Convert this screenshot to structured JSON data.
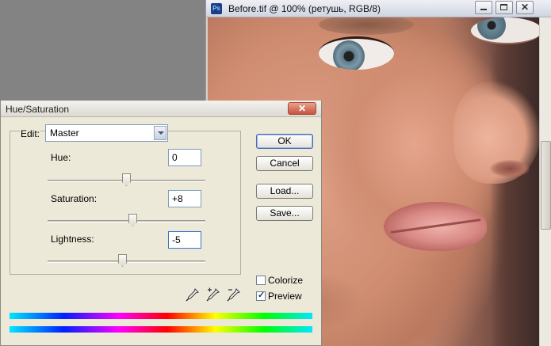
{
  "document": {
    "title": "Before.tif @ 100% (ретушь, RGB/8)",
    "icon": "photoshop-file-icon"
  },
  "dialog": {
    "title": "Hue/Saturation",
    "edit_label": "Edit:",
    "edit_value": "Master",
    "sliders": [
      {
        "label": "Hue:",
        "value": "0",
        "position_fraction": 0.5
      },
      {
        "label": "Saturation:",
        "value": "+8",
        "position_fraction": 0.54
      },
      {
        "label": "Lightness:",
        "value": "-5",
        "position_fraction": 0.475
      }
    ],
    "buttons": {
      "ok": "OK",
      "cancel": "Cancel",
      "load": "Load...",
      "save": "Save..."
    },
    "colorize": {
      "label": "Colorize",
      "checked": false
    },
    "preview": {
      "label": "Preview",
      "checked": true
    },
    "eyedroppers": [
      "eyedropper-icon",
      "eyedropper-plus-icon",
      "eyedropper-minus-icon"
    ]
  },
  "colors": {
    "dialog_bg": "#ece9d8",
    "workspace_bg": "#838383",
    "ok_border": "#4a6bb2"
  }
}
